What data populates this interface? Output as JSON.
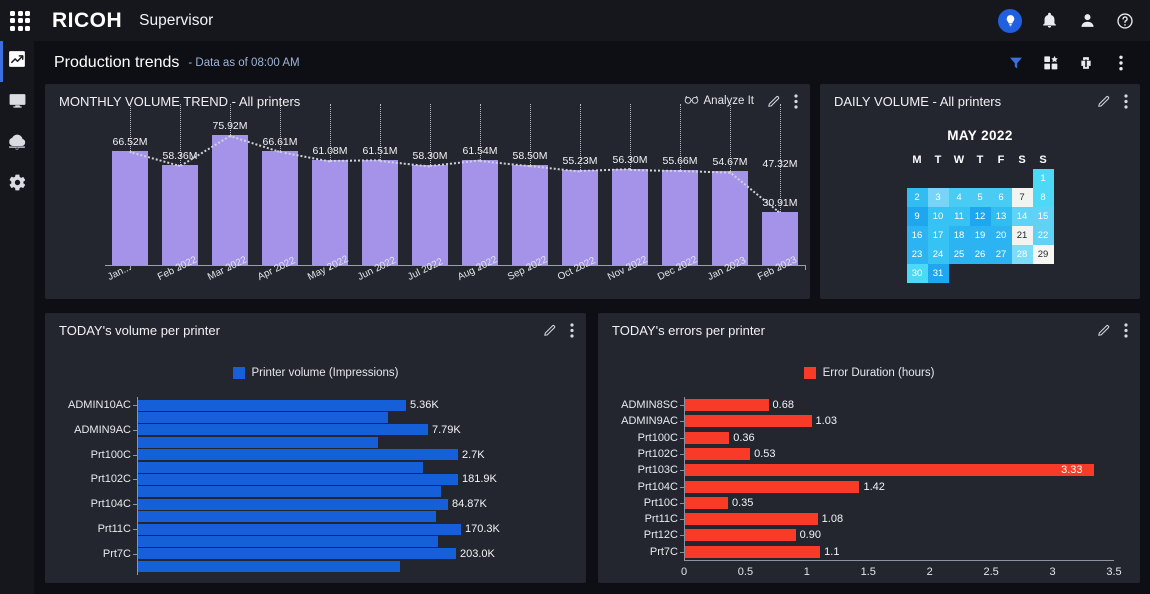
{
  "topbar": {
    "brand": "RICOH",
    "app_name": "Supervisor",
    "icons": {
      "apps_grid": "apps-grid-icon",
      "insight": "lightbulb-icon",
      "notifications": "bell-icon",
      "account": "user-icon",
      "help": "help-circle-icon"
    }
  },
  "sidebar": {
    "items": [
      {
        "name": "production-trends",
        "icon": "trend-chart-icon",
        "active": true
      },
      {
        "name": "monitor",
        "icon": "monitor-icon",
        "active": false
      },
      {
        "name": "cloud-upload",
        "icon": "cloud-upload-icon",
        "active": false
      },
      {
        "name": "settings",
        "icon": "gear-icon",
        "active": false
      }
    ]
  },
  "page_header": {
    "title": "Production trends",
    "subtitle": "- Data as of 08:00 AM",
    "tools": [
      "filter-icon",
      "widgets-icon",
      "printer-icon",
      "more-vertical-icon"
    ]
  },
  "colors": {
    "bar_purple": "#a493e8",
    "bar_blue": "#1560d8",
    "bar_red": "#f73b28",
    "accent_blue": "#3b6fe0",
    "panel_bg": "#23262f",
    "page_bg": "#0d0f14"
  },
  "panels": {
    "monthly": {
      "title": "MONTHLY VOLUME TREND - All printers",
      "analyze_label": "Analyze It",
      "analyze_icon": "goggles-icon",
      "edit_icon": "pencil-icon",
      "more_icon": "more-vertical-icon"
    },
    "daily": {
      "title": "DAILY VOLUME - All printers",
      "edit_icon": "pencil-icon",
      "more_icon": "more-vertical-icon",
      "calendar_title": "MAY 2022",
      "weekday_headers": [
        "M",
        "T",
        "W",
        "T",
        "F",
        "S",
        "S"
      ],
      "weeks": [
        [
          null,
          null,
          null,
          null,
          null,
          null,
          {
            "d": "1",
            "bg": "#4bd9f5",
            "fg": "#ffffff"
          }
        ],
        [
          {
            "d": "2",
            "bg": "#32bdf2",
            "fg": "#ffffff"
          },
          {
            "d": "3",
            "bg": "#78d4f7",
            "fg": "#ffffff"
          },
          {
            "d": "4",
            "bg": "#49cbf4",
            "fg": "#ffffff"
          },
          {
            "d": "5",
            "bg": "#49cbf4",
            "fg": "#ffffff"
          },
          {
            "d": "6",
            "bg": "#49cbf4",
            "fg": "#ffffff"
          },
          {
            "d": "7",
            "bg": "#f3f3ef",
            "fg": "#1c2330"
          },
          {
            "d": "8",
            "bg": "#4bd9f5",
            "fg": "#ffffff"
          }
        ],
        [
          {
            "d": "9",
            "bg": "#1ea6ef",
            "fg": "#ffffff"
          },
          {
            "d": "10",
            "bg": "#36c2f3",
            "fg": "#ffffff"
          },
          {
            "d": "11",
            "bg": "#36c2f3",
            "fg": "#ffffff"
          },
          {
            "d": "12",
            "bg": "#1ea6ef",
            "fg": "#ffffff"
          },
          {
            "d": "13",
            "bg": "#30bdf2",
            "fg": "#ffffff"
          },
          {
            "d": "14",
            "bg": "#5fd2f6",
            "fg": "#ffffff"
          },
          {
            "d": "15",
            "bg": "#5fd2f6",
            "fg": "#ffffff"
          }
        ],
        [
          {
            "d": "16",
            "bg": "#2bb4f1",
            "fg": "#ffffff"
          },
          {
            "d": "17",
            "bg": "#36c2f3",
            "fg": "#ffffff"
          },
          {
            "d": "18",
            "bg": "#2bb4f1",
            "fg": "#ffffff"
          },
          {
            "d": "19",
            "bg": "#2bb4f1",
            "fg": "#ffffff"
          },
          {
            "d": "20",
            "bg": "#2bb4f1",
            "fg": "#ffffff"
          },
          {
            "d": "21",
            "bg": "#f3f3ef",
            "fg": "#1c2330"
          },
          {
            "d": "22",
            "bg": "#5fd2f6",
            "fg": "#ffffff"
          }
        ],
        [
          {
            "d": "23",
            "bg": "#2bb4f1",
            "fg": "#ffffff"
          },
          {
            "d": "24",
            "bg": "#36c2f3",
            "fg": "#ffffff"
          },
          {
            "d": "25",
            "bg": "#2bb4f1",
            "fg": "#ffffff"
          },
          {
            "d": "26",
            "bg": "#2bb4f1",
            "fg": "#ffffff"
          },
          {
            "d": "27",
            "bg": "#2bb4f1",
            "fg": "#ffffff"
          },
          {
            "d": "28",
            "bg": "#7ddcf8",
            "fg": "#ffffff"
          },
          {
            "d": "29",
            "bg": "#f7f7f2",
            "fg": "#1c2330"
          }
        ],
        [
          {
            "d": "30",
            "bg": "#4bd9f5",
            "fg": "#ffffff"
          },
          {
            "d": "31",
            "bg": "#1ea6ef",
            "fg": "#ffffff"
          },
          null,
          null,
          null,
          null,
          null
        ]
      ]
    },
    "volume": {
      "title": "TODAY's volume per printer",
      "edit_icon": "pencil-icon",
      "more_icon": "more-vertical-icon"
    },
    "errors": {
      "title": "TODAY's errors per printer",
      "edit_icon": "pencil-icon",
      "more_icon": "more-vertical-icon"
    }
  },
  "chart_data": [
    {
      "id": "monthly-volume-trend",
      "type": "bar",
      "title": "MONTHLY VOLUME TREND - All printers",
      "xlabel": "",
      "ylabel": "",
      "ylim": [
        0,
        80
      ],
      "grid": false,
      "legend": null,
      "categories": [
        "Jan...",
        "Feb 2022",
        "Mar 2022",
        "Apr 2022",
        "May 2022",
        "Jun 2022",
        "Jul 2022",
        "Aug 2022",
        "Sep 2022",
        "Oct 2022",
        "Nov 2022",
        "Dec 2022",
        "Jan 2023",
        "Feb 2023"
      ],
      "values": [
        66.52,
        58.36,
        75.92,
        66.61,
        61.08,
        61.51,
        58.3,
        61.54,
        58.5,
        55.23,
        56.3,
        55.66,
        54.67,
        30.91
      ],
      "data_labels": [
        "66.52M",
        "58.36M",
        "75.92M",
        "66.61M",
        "61.08M",
        "61.51M",
        "58.30M",
        "61.54M",
        "58.50M",
        "55.23M",
        "56.30M",
        "55.66M",
        "54.67M",
        "30.91M"
      ],
      "forecast_label": "47.32M",
      "unit": "M"
    },
    {
      "id": "daily-volume-heatmap",
      "type": "heatmap",
      "title": "DAILY VOLUME - All printers",
      "period": "MAY 2022",
      "xlabel": "",
      "ylabel": "",
      "categories": [
        "M",
        "T",
        "W",
        "T",
        "F",
        "S",
        "S"
      ],
      "values": [
        1,
        2,
        3,
        4,
        5,
        6,
        7,
        8,
        9,
        10,
        11,
        12,
        13,
        14,
        15,
        16,
        17,
        18,
        19,
        20,
        21,
        22,
        23,
        24,
        25,
        26,
        27,
        28,
        29,
        30,
        31
      ]
    },
    {
      "id": "today-volume-per-printer",
      "type": "bar",
      "orientation": "horizontal",
      "title": "TODAY's volume per printer",
      "legend": "Printer volume (Impressions)",
      "legend_position": "top-center",
      "xlabel": "",
      "ylabel": "",
      "grid": false,
      "categories": [
        "ADMIN10AC",
        "ADMIN9AC",
        "Prt100C",
        "Prt102C",
        "Prt104C",
        "Prt11C",
        "Prt7C"
      ],
      "values": [
        5.36,
        7.79,
        2.7,
        181.9,
        84.87,
        170.3,
        203.0
      ],
      "data_labels": [
        "5.36K",
        "7.79K",
        "2.7K",
        "181.9K",
        "84.87K",
        "170.3K",
        "203.0K"
      ],
      "unit": "K"
    },
    {
      "id": "today-errors-per-printer",
      "type": "bar",
      "orientation": "horizontal",
      "title": "TODAY's errors per printer",
      "legend": "Error Duration (hours)",
      "legend_position": "top-center",
      "xlabel": "",
      "ylabel": "",
      "grid": false,
      "xlim": [
        0,
        3.5
      ],
      "xticks": [
        "0",
        "0.5",
        "1",
        "1.5",
        "2",
        "2.5",
        "3",
        "3.5"
      ],
      "categories": [
        "ADMIN8SC",
        "ADMIN9AC",
        "Prt100C",
        "Prt102C",
        "Prt103C",
        "Prt104C",
        "Prt10C",
        "Prt11C",
        "Prt12C",
        "Prt7C"
      ],
      "values": [
        0.68,
        1.03,
        0.36,
        0.53,
        3.33,
        1.42,
        0.35,
        1.08,
        0.9,
        1.1
      ],
      "data_labels": [
        "0.68",
        "1.03",
        "0.36",
        "0.53",
        "3.33",
        "1.42",
        "0.35",
        "1.08",
        "0.90",
        "1.1"
      ],
      "unit": "hours"
    }
  ]
}
